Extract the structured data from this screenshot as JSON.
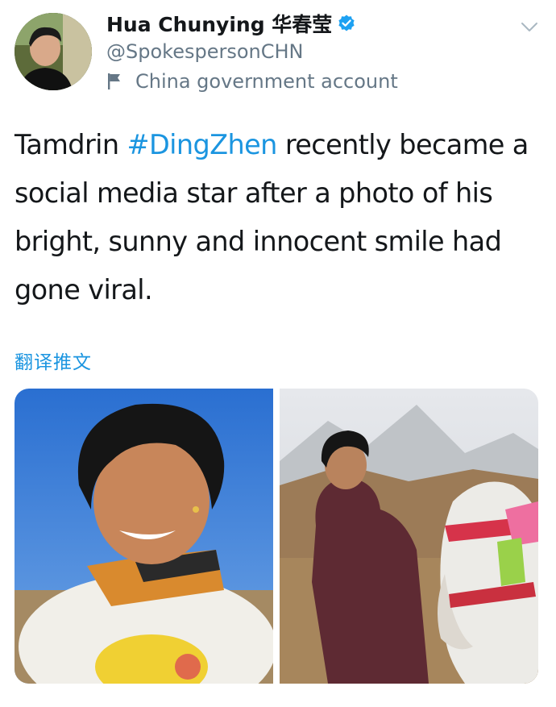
{
  "author": {
    "display_name": "Hua Chunying 华春莹",
    "handle": "@SpokespersonCHN",
    "account_label": "China government account",
    "verified": true,
    "avatar_icon": "avatar"
  },
  "tweet": {
    "text_before": "Tamdrin ",
    "hashtag": "#DingZhen",
    "text_after": " recently became a social media star after a photo of his bright, sunny and innocent smile had gone viral.",
    "translate_label": "翻译推文"
  },
  "media": {
    "count": 2,
    "photos": [
      "photo-smiling-portrait",
      "photo-with-horse"
    ]
  },
  "colors": {
    "accent": "#1b95e0",
    "text": "#14171a",
    "secondary_text": "#657786"
  },
  "icons": {
    "verified": "verified-badge-icon",
    "government": "flag-icon",
    "menu": "chevron-down-icon"
  }
}
